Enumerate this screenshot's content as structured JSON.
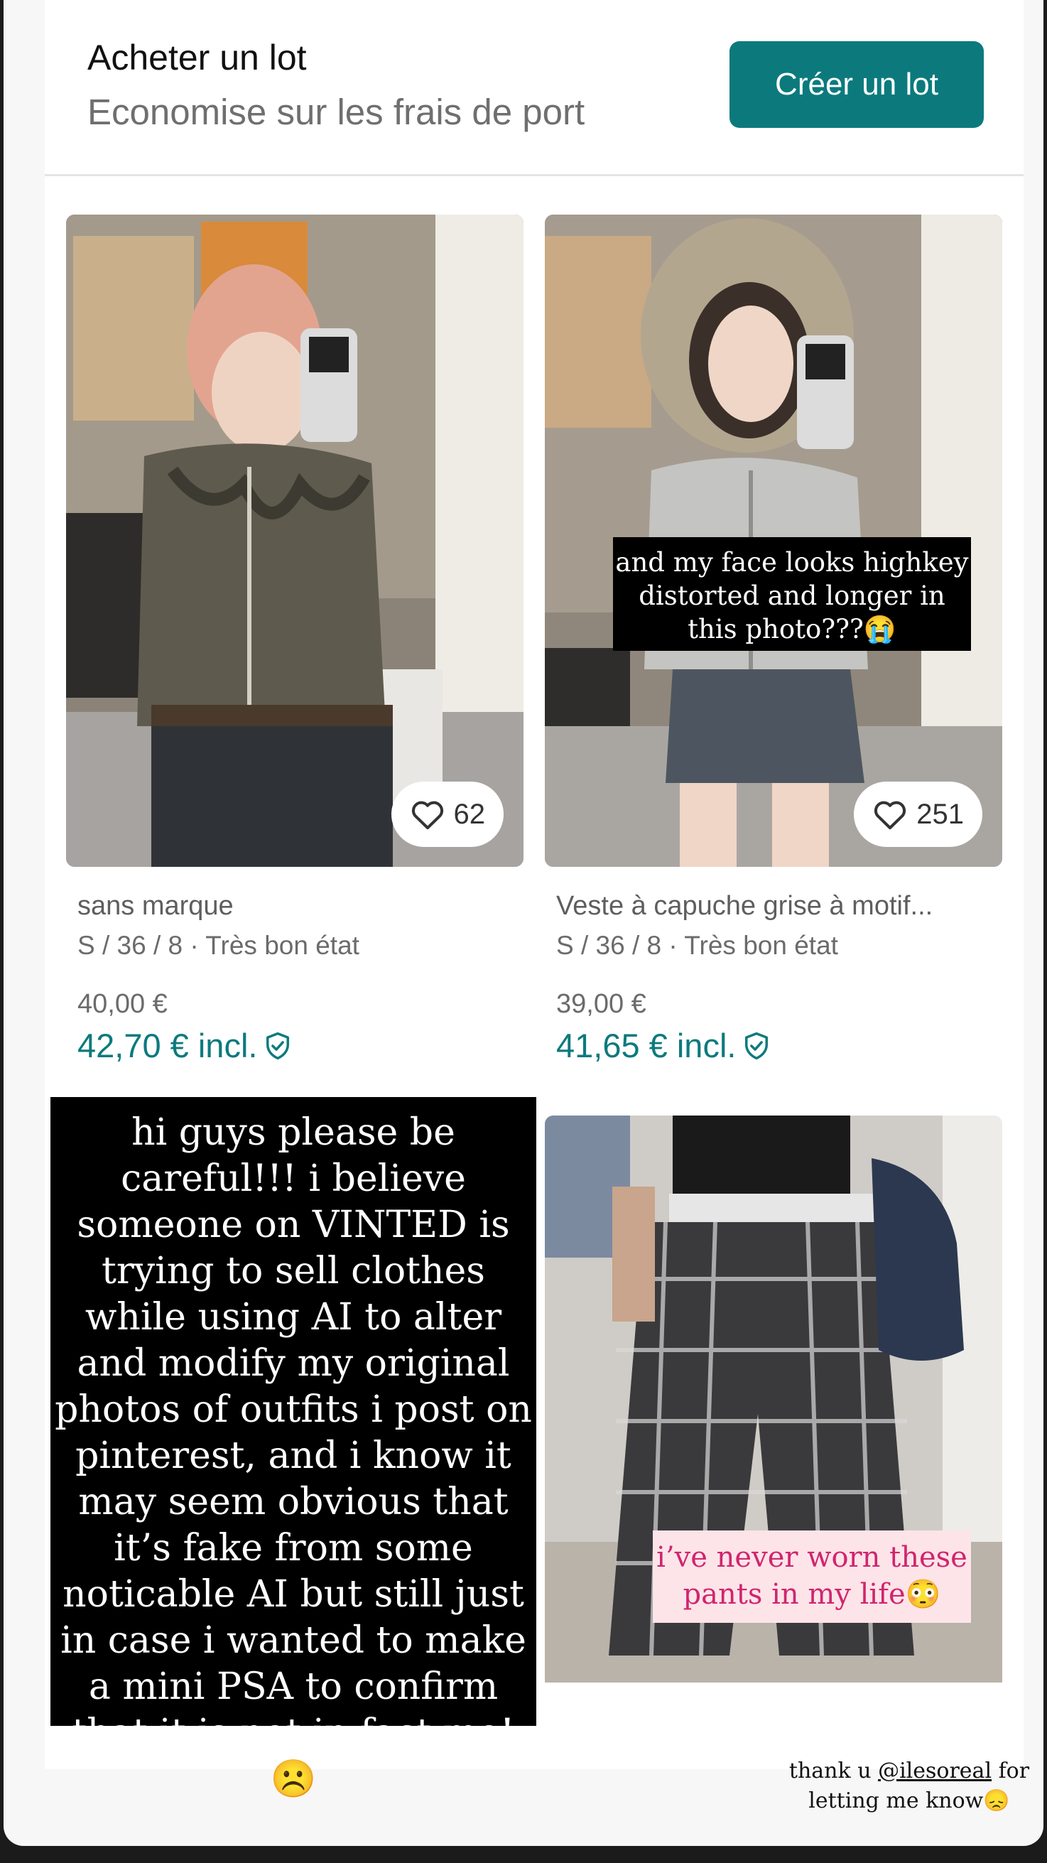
{
  "bundle": {
    "title": "Acheter un lot",
    "subtitle": "Economise sur les frais de port",
    "button": "Créer un lot"
  },
  "items": [
    {
      "likes": "62",
      "brand": "sans marque",
      "meta": "S / 36 / 8 · Très bon état",
      "price": "40,00 €",
      "price_incl": "42,70 € incl."
    },
    {
      "likes": "251",
      "brand": "Veste à capuche grise à motif...",
      "meta": "S / 36 / 8 · Très bon état",
      "price": "39,00 €",
      "price_incl": "41,65 € incl."
    }
  ],
  "story": {
    "face_caption": "and my face looks highkey distorted and longer in this photo???😭",
    "psa_caption": "hi guys please be careful!!! i believe someone on VINTED is trying to sell clothes while using AI to alter and modify my original photos of outfits i post on pinterest, and i know it may seem obvious that it’s fake from some noticable AI but still just in case i wanted to make a mini PSA to confirm that it is not in fact me!☹️",
    "pants_caption": "i’ve never worn these pants in my life😳",
    "thanks_prefix": "thank u ",
    "thanks_handle": "@ilesoreal",
    "thanks_suffix": " for letting me know😞"
  },
  "colors": {
    "accent": "#0c7a7d",
    "pink_text": "#d0256f",
    "pink_bg": "#fde4e8"
  },
  "icons": {
    "like": "heart-outline-icon",
    "buyer_protection": "shield-check-icon"
  }
}
